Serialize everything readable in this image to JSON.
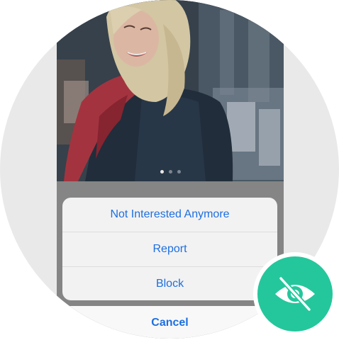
{
  "action_sheet": {
    "items": [
      {
        "label": "Not Interested Anymore"
      },
      {
        "label": "Report"
      },
      {
        "label": "Block"
      }
    ],
    "cancel_label": "Cancel"
  },
  "photo": {
    "page_count": 3,
    "active_page": 1
  },
  "badge": {
    "icon": "eye-off-icon",
    "color": "#24c79b"
  },
  "colors": {
    "link_blue": "#1d6fe0",
    "frame_gray": "#e9e9e9"
  }
}
